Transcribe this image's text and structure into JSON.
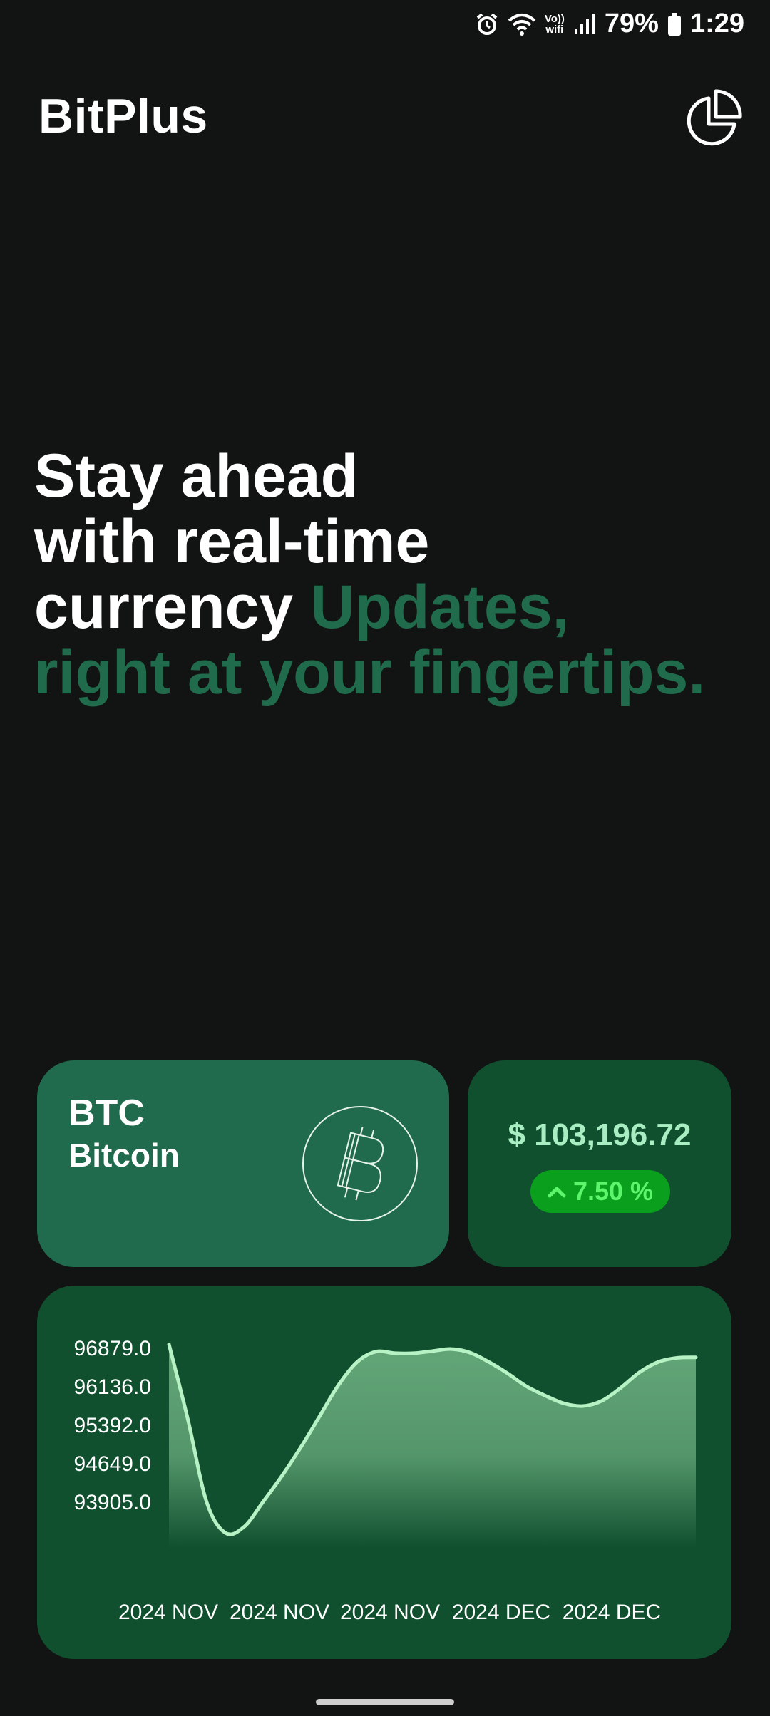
{
  "status_bar": {
    "battery": "79%",
    "time": "1:29",
    "vowifi_top": "Vo))",
    "vowifi_bottom": "wifi",
    "icons": [
      "alarm-icon",
      "wifi-icon",
      "vowifi-icon",
      "signal-icon",
      "battery-icon"
    ]
  },
  "header": {
    "title": "BitPlus",
    "portfolio_icon": "pie-chart-icon"
  },
  "hero": {
    "line1": "Stay ahead",
    "line2": "with real-time",
    "line3_white": "currency",
    "line3_green": "Updates,",
    "line4": "right at your fingertips."
  },
  "coin": {
    "symbol": "BTC",
    "name": "Bitcoin",
    "icon": "bitcoin-icon",
    "price": "$ 103,196.72",
    "change": "7.50 %",
    "change_icon": "chevron-up-icon"
  },
  "colors": {
    "background": "#111412",
    "accent_green": "#1f6b4c",
    "card_dark": "#11502f",
    "card_mid": "#206b4e",
    "line": "#b6f2c4",
    "badge_bg": "#0aa01e",
    "badge_text": "#5cf56b"
  },
  "chart_data": {
    "type": "area",
    "y_ticks": [
      "96879.0",
      "96136.0",
      "95392.0",
      "94649.0",
      "93905.0"
    ],
    "x_ticks": [
      "2024 NOV",
      "2024 NOV",
      "2024 NOV",
      "2024 DEC",
      "2024 DEC"
    ],
    "ylim": [
      93150,
      97250
    ],
    "x": [
      0,
      1,
      2,
      3,
      4,
      5,
      6,
      7,
      8,
      9,
      10,
      11,
      12,
      13,
      14,
      15,
      16,
      17,
      18,
      19,
      20,
      21,
      22,
      23,
      24,
      25,
      26,
      27,
      28
    ],
    "values": [
      96940,
      95500,
      93900,
      93300,
      93420,
      93900,
      94400,
      94950,
      95550,
      96150,
      96600,
      96800,
      96770,
      96770,
      96810,
      96850,
      96780,
      96600,
      96380,
      96130,
      95950,
      95800,
      95750,
      95850,
      96100,
      96400,
      96600,
      96680,
      96690
    ]
  }
}
